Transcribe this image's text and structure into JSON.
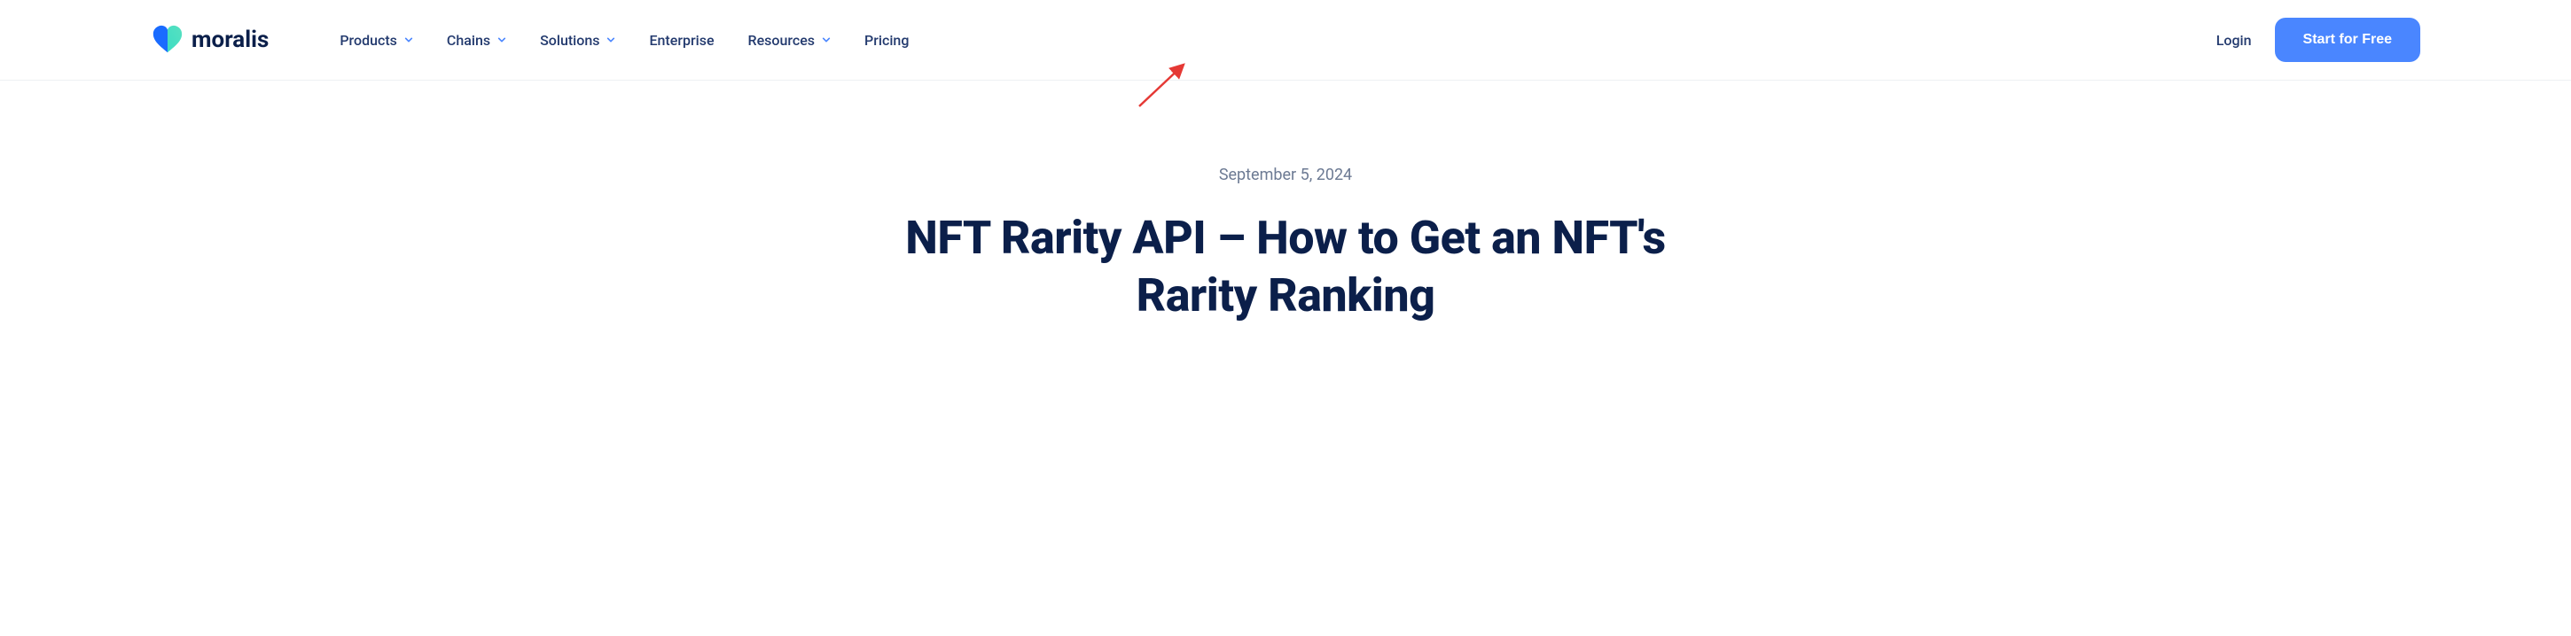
{
  "brand": {
    "name": "moralis"
  },
  "nav": {
    "products": "Products",
    "chains": "Chains",
    "solutions": "Solutions",
    "enterprise": "Enterprise",
    "resources": "Resources",
    "pricing": "Pricing"
  },
  "actions": {
    "login": "Login",
    "cta": "Start for Free"
  },
  "article": {
    "date": "September 5, 2024",
    "title": "NFT Rarity API – How to Get an NFT's Rarity Ranking"
  }
}
